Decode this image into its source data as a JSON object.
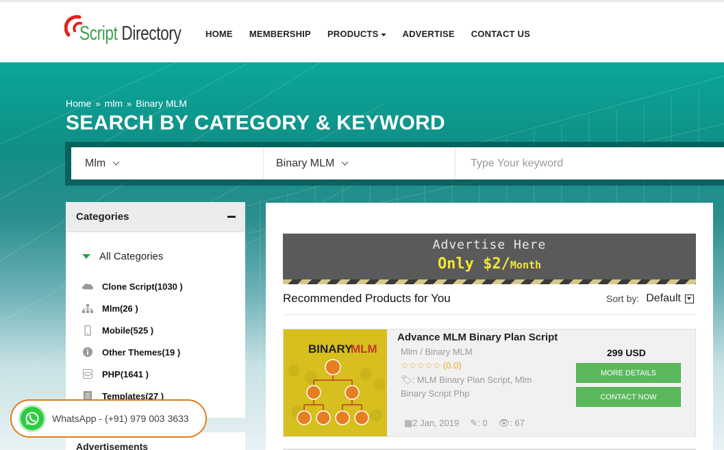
{
  "header": {
    "logo": {
      "part1": "Script",
      "part2": "Directory"
    },
    "nav": [
      {
        "label": "HOME"
      },
      {
        "label": "MEMBERSHIP"
      },
      {
        "label": "PRODUCTS"
      },
      {
        "label": "ADVERTISE"
      },
      {
        "label": "CONTACT US"
      }
    ]
  },
  "breadcrumb": {
    "items": [
      "Home",
      "mlm",
      "Binary MLM"
    ],
    "separator": "»"
  },
  "hero": {
    "title": "SEARCH BY CATEGORY & KEYWORD"
  },
  "search": {
    "category": "Mlm",
    "subcategory": "Binary MLM",
    "keyword_placeholder": "Type Your keyword"
  },
  "sidebar": {
    "categories_title": "Categories",
    "all_categories": "All Categories",
    "items": [
      {
        "label": "Clone Script(1030 )",
        "icon": "cloud-icon"
      },
      {
        "label": "Mlm(26 )",
        "icon": "sitemap-icon"
      },
      {
        "label": "Mobile(525 )",
        "icon": "mobile-icon"
      },
      {
        "label": "Other Themes(19 )",
        "icon": "info-icon"
      },
      {
        "label": "PHP(1641 )",
        "icon": "php-icon"
      },
      {
        "label": "Templates(27 )",
        "icon": "document-icon"
      }
    ],
    "ads_title": "Advertisements"
  },
  "banner": {
    "line1": "Advertise Here",
    "price": "Only $2/",
    "unit": "Month"
  },
  "recommended": {
    "title": "Recommended Products for You",
    "sort_label": "Sort by:",
    "sort_value": "Default"
  },
  "product": {
    "image_text": "BINARY MLM",
    "name": "Advance MLM Binary Plan Script",
    "category": "Mlm / Binary MLM",
    "stars": "☆☆☆☆☆",
    "rating": "(0.0)",
    "tags": ": MLM Binary Plan Script, Mlm Binary Script Php",
    "date": "2 Jan, 2019",
    "comments": ": 0",
    "views": ": 67",
    "price": "299 USD",
    "details_button": "MORE DETAILS",
    "contact_button": "CONTACT NOW"
  },
  "whatsapp": {
    "label": "WhatsApp - (+91) 979 003 3633"
  },
  "colors": {
    "teal": "#0aa79a",
    "green": "#5cb85c",
    "whatsapp_border": "#e07b1a",
    "banner_yellow": "#f2e635"
  }
}
